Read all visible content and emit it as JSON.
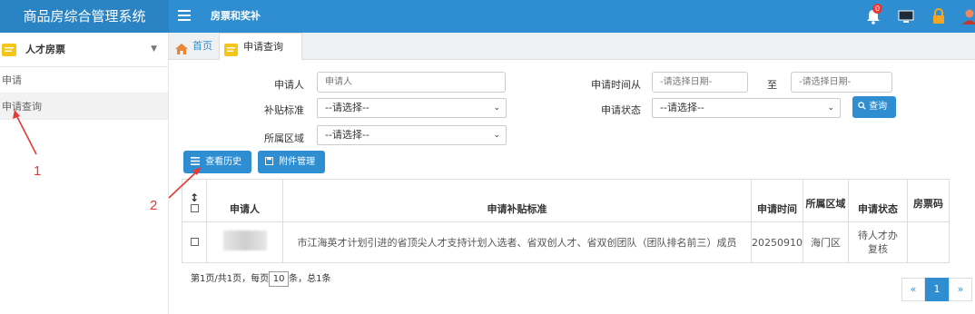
{
  "header": {
    "app_title": "商品房综合管理系统",
    "module_title": "房票和奖补",
    "notification_count": "0",
    "icons": [
      "bell-icon",
      "monitor-icon",
      "lock-icon",
      "user-icon"
    ],
    "accent_color": "#2f8ed1"
  },
  "sidebar": {
    "section_label": "人才房票",
    "items": [
      {
        "label": "申请"
      },
      {
        "label": "申请查询",
        "active": true
      }
    ]
  },
  "tabs": [
    {
      "label": "首页"
    },
    {
      "label": "申请查询",
      "active": true
    }
  ],
  "form": {
    "applicant_label": "申请人",
    "applicant_placeholder": "申请人",
    "date_from_label": "申请时间从",
    "date_from_placeholder": "-请选择日期-",
    "date_to_label": "至",
    "date_to_placeholder": "-请选择日期-",
    "subsidy_label": "补贴标准",
    "subsidy_value": "--请选择--",
    "status_label": "申请状态",
    "status_value": "--请选择--",
    "region_label": "所属区域",
    "region_value": "--请选择--",
    "search_button": "查询"
  },
  "toolbar": {
    "history_button": "查看历史",
    "attachment_button": "附件管理"
  },
  "table": {
    "columns": [
      "申请人",
      "申请补贴标准",
      "申请时间",
      "所属区域",
      "申请状态",
      "房票码"
    ],
    "rows": [
      {
        "applicant": "",
        "subsidy": "市江海英才计划引进的省顶尖人才支持计划入选者、省双创人才、省双创团队（团队排名前三）成员",
        "time": "20250910",
        "region": "海门区",
        "status": "待人才办复核",
        "code": ""
      }
    ]
  },
  "pagination": {
    "info_prefix": "第1页/共1页，每页",
    "page_size": "10",
    "info_suffix": "条，总1条",
    "prev": "«",
    "current": "1",
    "next": "»"
  },
  "annotations": {
    "marker_1": "1",
    "marker_2": "2",
    "color": "#e53935"
  }
}
